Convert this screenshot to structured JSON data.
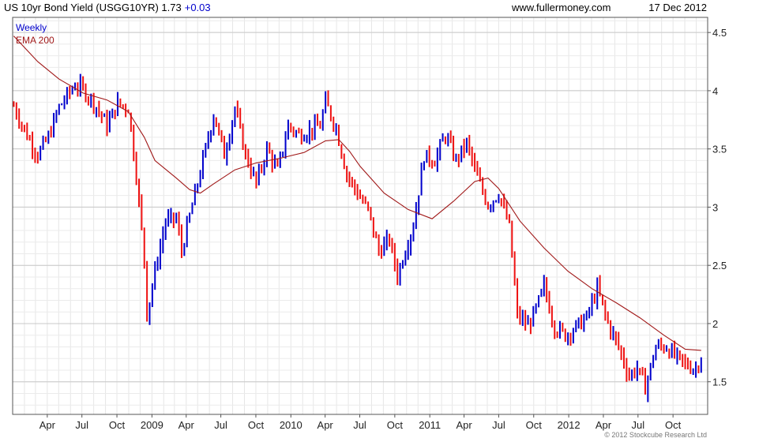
{
  "header": {
    "title": "US 10yr Bond Yield (USGG10YR) 1.73",
    "change": "+0.03",
    "site": "www.fullermoney.com",
    "date": "17 Dec 2012"
  },
  "legend": {
    "weekly": "Weekly",
    "ema": "EMA 200"
  },
  "copyright": "© 2012 Stockcube Research Ltd",
  "colors": {
    "up": "#0000cc",
    "down": "#ee1111",
    "ema": "#a01818",
    "grid": "#d4d4d4",
    "title_change": "#0000cc"
  },
  "chart_data": {
    "type": "line",
    "title": "US 10yr Bond Yield (USGG10YR)",
    "ylim": [
      1.22,
      4.63
    ],
    "y_ticks": [
      "1.5",
      "2",
      "2.5",
      "3",
      "3.5",
      "4",
      "4.5"
    ],
    "x_tick_labels": [
      "Apr",
      "Jul",
      "Oct",
      "2009",
      "Apr",
      "Jul",
      "Oct",
      "2010",
      "Apr",
      "Jul",
      "Oct",
      "2011",
      "Apr",
      "Jul",
      "Oct",
      "2012",
      "Apr",
      "Jul",
      "Oct"
    ],
    "x_range": [
      "2008-01-01",
      "2012-12-31"
    ],
    "grid": true,
    "legend_position": "top-left",
    "series": [
      {
        "name": "Weekly",
        "style": "ohlc-bars, blue up / red down",
        "x": [
          "2008-01-04",
          "2008-02-01",
          "2008-03-07",
          "2008-04-04",
          "2008-05-02",
          "2008-06-13",
          "2008-07-04",
          "2008-08-01",
          "2008-09-05",
          "2008-10-03",
          "2008-10-31",
          "2008-11-21",
          "2008-12-12",
          "2008-12-19",
          "2009-01-09",
          "2009-02-06",
          "2009-03-06",
          "2009-03-20",
          "2009-04-10",
          "2009-05-08",
          "2009-06-12",
          "2009-07-10",
          "2009-08-07",
          "2009-09-04",
          "2009-10-02",
          "2009-10-30",
          "2009-11-27",
          "2009-12-25",
          "2010-01-22",
          "2010-02-19",
          "2010-03-19",
          "2010-04-02",
          "2010-04-30",
          "2010-05-28",
          "2010-06-25",
          "2010-07-23",
          "2010-08-20",
          "2010-09-17",
          "2010-10-08",
          "2010-10-29",
          "2010-11-19",
          "2010-12-17",
          "2011-01-14",
          "2011-02-11",
          "2011-03-11",
          "2011-04-08",
          "2011-05-06",
          "2011-06-03",
          "2011-07-01",
          "2011-07-29",
          "2011-08-19",
          "2011-09-16",
          "2011-10-07",
          "2011-10-28",
          "2011-11-25",
          "2011-12-23",
          "2012-01-20",
          "2012-02-17",
          "2012-03-16",
          "2012-04-13",
          "2012-05-11",
          "2012-06-08",
          "2012-06-29",
          "2012-07-20",
          "2012-08-17",
          "2012-09-14",
          "2012-10-05",
          "2012-11-02",
          "2012-11-30",
          "2012-12-14"
        ],
        "y": [
          3.87,
          3.66,
          3.45,
          3.6,
          3.86,
          4.05,
          4.01,
          3.9,
          3.7,
          3.89,
          3.85,
          3.28,
          2.55,
          2.08,
          2.45,
          2.88,
          2.9,
          2.62,
          2.92,
          3.3,
          3.8,
          3.45,
          3.85,
          3.45,
          3.2,
          3.5,
          3.31,
          3.7,
          3.62,
          3.66,
          3.7,
          3.9,
          3.68,
          3.28,
          3.12,
          2.97,
          2.62,
          2.72,
          2.41,
          2.64,
          2.85,
          3.44,
          3.4,
          3.62,
          3.4,
          3.55,
          3.25,
          3.02,
          3.12,
          2.83,
          2.07,
          1.98,
          2.12,
          2.32,
          1.97,
          1.9,
          1.97,
          2.05,
          2.3,
          2.0,
          1.8,
          1.55,
          1.62,
          1.45,
          1.8,
          1.8,
          1.72,
          1.65,
          1.61,
          1.73
        ]
      },
      {
        "name": "EMA 200",
        "x": [
          "2008-01-04",
          "2008-03-07",
          "2008-05-02",
          "2008-07-04",
          "2008-09-05",
          "2008-10-31",
          "2008-12-12",
          "2009-01-09",
          "2009-03-06",
          "2009-04-10",
          "2009-05-08",
          "2009-06-12",
          "2009-08-07",
          "2009-10-02",
          "2009-12-04",
          "2010-02-05",
          "2010-04-02",
          "2010-05-07",
          "2010-06-04",
          "2010-07-02",
          "2010-09-03",
          "2010-11-05",
          "2011-01-07",
          "2011-03-04",
          "2011-04-29",
          "2011-06-03",
          "2011-07-01",
          "2011-08-26",
          "2011-10-28",
          "2011-12-30",
          "2012-03-02",
          "2012-05-04",
          "2012-07-06",
          "2012-09-07",
          "2012-11-02",
          "2012-12-14"
        ],
        "y": [
          4.47,
          4.25,
          4.1,
          3.98,
          3.92,
          3.82,
          3.6,
          3.4,
          3.25,
          3.15,
          3.12,
          3.2,
          3.32,
          3.38,
          3.42,
          3.47,
          3.57,
          3.58,
          3.48,
          3.35,
          3.12,
          2.98,
          2.9,
          3.05,
          3.22,
          3.25,
          3.16,
          2.88,
          2.65,
          2.45,
          2.3,
          2.18,
          2.05,
          1.9,
          1.78,
          1.77
        ]
      }
    ]
  }
}
